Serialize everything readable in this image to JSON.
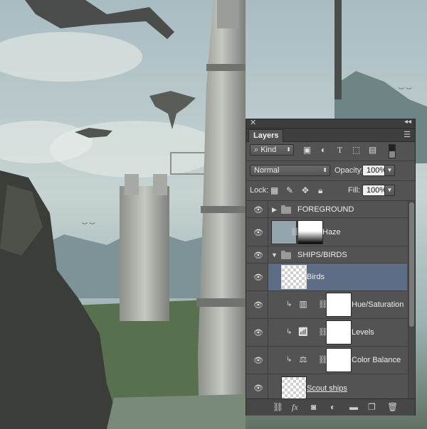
{
  "panel": {
    "tab_label": "Layers",
    "close_glyph": "✕",
    "collapse_glyph": "◂◂",
    "menu_glyph": "☰"
  },
  "filter": {
    "kind_label": "Kind",
    "icons": [
      "image-filter-icon",
      "adjustment-filter-icon",
      "type-filter-icon",
      "shape-filter-icon",
      "smart-object-filter-icon",
      "filter-toggle"
    ]
  },
  "blend": {
    "mode": "Normal",
    "opacity_label": "Opacity:",
    "opacity_value": "100%"
  },
  "lock": {
    "label": "Lock:",
    "fill_label": "Fill:",
    "fill_value": "100%"
  },
  "layers": [
    {
      "name": "FOREGROUND",
      "type": "group",
      "expanded": false
    },
    {
      "name": "Haze",
      "type": "layer-with-mask"
    },
    {
      "name": "SHIPS/BIRDS",
      "type": "group",
      "expanded": true
    },
    {
      "name": "Birds",
      "type": "layer",
      "selected": true
    },
    {
      "name": "Hue/Saturation",
      "type": "adjustment",
      "clipped": true
    },
    {
      "name": "Levels",
      "type": "adjustment",
      "clipped": true
    },
    {
      "name": "Color Balance",
      "type": "adjustment",
      "clipped": true
    },
    {
      "name": "Scout ships",
      "type": "layer"
    }
  ],
  "colors": {
    "panel_bg": "#535353",
    "selected_row": "#5d6d86",
    "sky": "#c9d6d6"
  }
}
